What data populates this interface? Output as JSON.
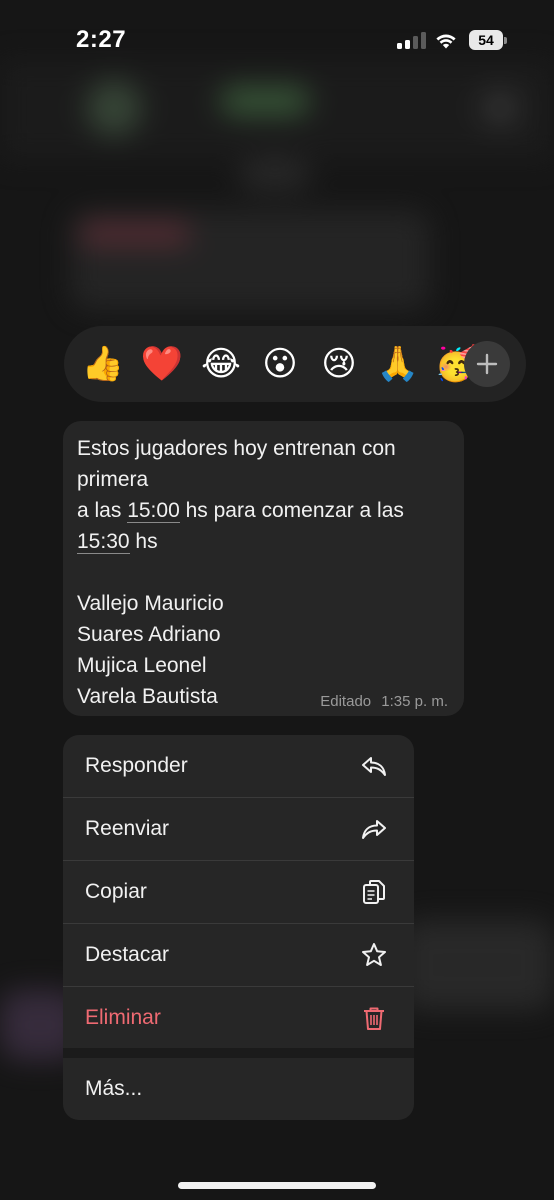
{
  "status_bar": {
    "time": "2:27",
    "battery": "54"
  },
  "reactions": [
    {
      "icon": "thumbs-up-icon",
      "glyph": "👍"
    },
    {
      "icon": "heart-icon",
      "glyph": "❤️"
    },
    {
      "icon": "tears-of-joy-icon",
      "glyph": "😂"
    },
    {
      "icon": "surprised-face-icon",
      "glyph": "😮"
    },
    {
      "icon": "crying-face-icon",
      "glyph": "😢"
    },
    {
      "icon": "folded-hands-icon",
      "glyph": "🙏"
    },
    {
      "icon": "partying-face-icon",
      "glyph": "🥳"
    }
  ],
  "message": {
    "line1": "Estos jugadores hoy entrenan con",
    "line2": "primera",
    "line3_pre": "a las ",
    "time1": "15:00",
    "line3_post": " hs para comenzar a las",
    "time2": "15:30",
    "line4_post": " hs",
    "players": [
      "Vallejo Mauricio",
      "Suares Adriano",
      "Mujica Leonel",
      "Varela Bautista"
    ],
    "edited_label": "Editado",
    "timestamp": "1:35 p. m."
  },
  "menu": {
    "items": [
      {
        "label": "Responder",
        "icon": "reply-icon"
      },
      {
        "label": "Reenviar",
        "icon": "forward-icon"
      },
      {
        "label": "Copiar",
        "icon": "copy-icon"
      },
      {
        "label": "Destacar",
        "icon": "star-icon"
      },
      {
        "label": "Eliminar",
        "icon": "trash-icon"
      }
    ],
    "more_label": "Más..."
  },
  "colors": {
    "danger": "#ef6a72",
    "menu_bg": "#262626",
    "bubble_bg": "#262626"
  }
}
